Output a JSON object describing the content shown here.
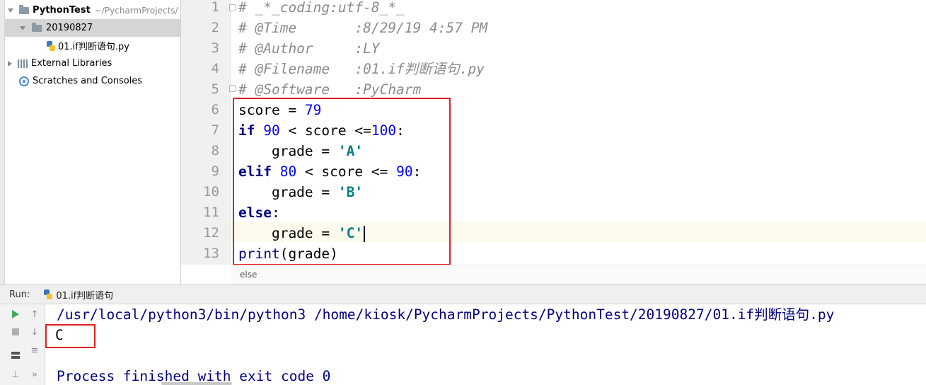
{
  "project_tree": {
    "root": {
      "name": "PythonTest",
      "path": "~/PycharmProjects/"
    },
    "folder": "20190827",
    "file": "01.if判断语句.py",
    "external_libraries": "External Libraries",
    "scratches": "Scratches and Consoles"
  },
  "editor": {
    "line_numbers": [
      "1",
      "2",
      "3",
      "4",
      "5",
      "6",
      "7",
      "8",
      "9",
      "10",
      "11",
      "12",
      "13"
    ],
    "header": {
      "l1": "# _*_coding:utf-8_*_",
      "l2": "# @Time       :8/29/19 4:57 PM",
      "l3": "# @Author     :LY",
      "l4": "# @Filename   :01.if判断语句.py",
      "l5": "# @Software   :PyCharm"
    },
    "code": {
      "l6_var": "score = ",
      "l6_num": "79",
      "l7_kw": "if",
      "l7_a": " ",
      "l7_n1": "90",
      "l7_b": " < score <=",
      "l7_n2": "100",
      "l7_c": ":",
      "l8_a": "    grade = ",
      "l8_s": "'A'",
      "l9_kw": "elif",
      "l9_a": " ",
      "l9_n1": "80",
      "l9_b": " < score <= ",
      "l9_n2": "90",
      "l9_c": ":",
      "l10_a": "    grade = ",
      "l10_s": "'B'",
      "l11_kw": "else",
      "l11_c": ":",
      "l12_a": "    grade = ",
      "l12_s": "'C'",
      "l13_fn": "print",
      "l13_rest": "(grade)"
    },
    "breadcrumb": "else"
  },
  "run": {
    "label": "Run:",
    "tab": "01.if判断语句",
    "command": "/usr/local/python3/bin/python3 /home/kiosk/PycharmProjects/PythonTest/20190827/01.if判断语句.py",
    "output": "C",
    "finish": "Process finished with exit code 0"
  },
  "colors": {
    "highlight_box": "#e02020",
    "keyword": "#000080",
    "number": "#0000ff",
    "string": "#008080",
    "comment": "#8c8c8c"
  }
}
